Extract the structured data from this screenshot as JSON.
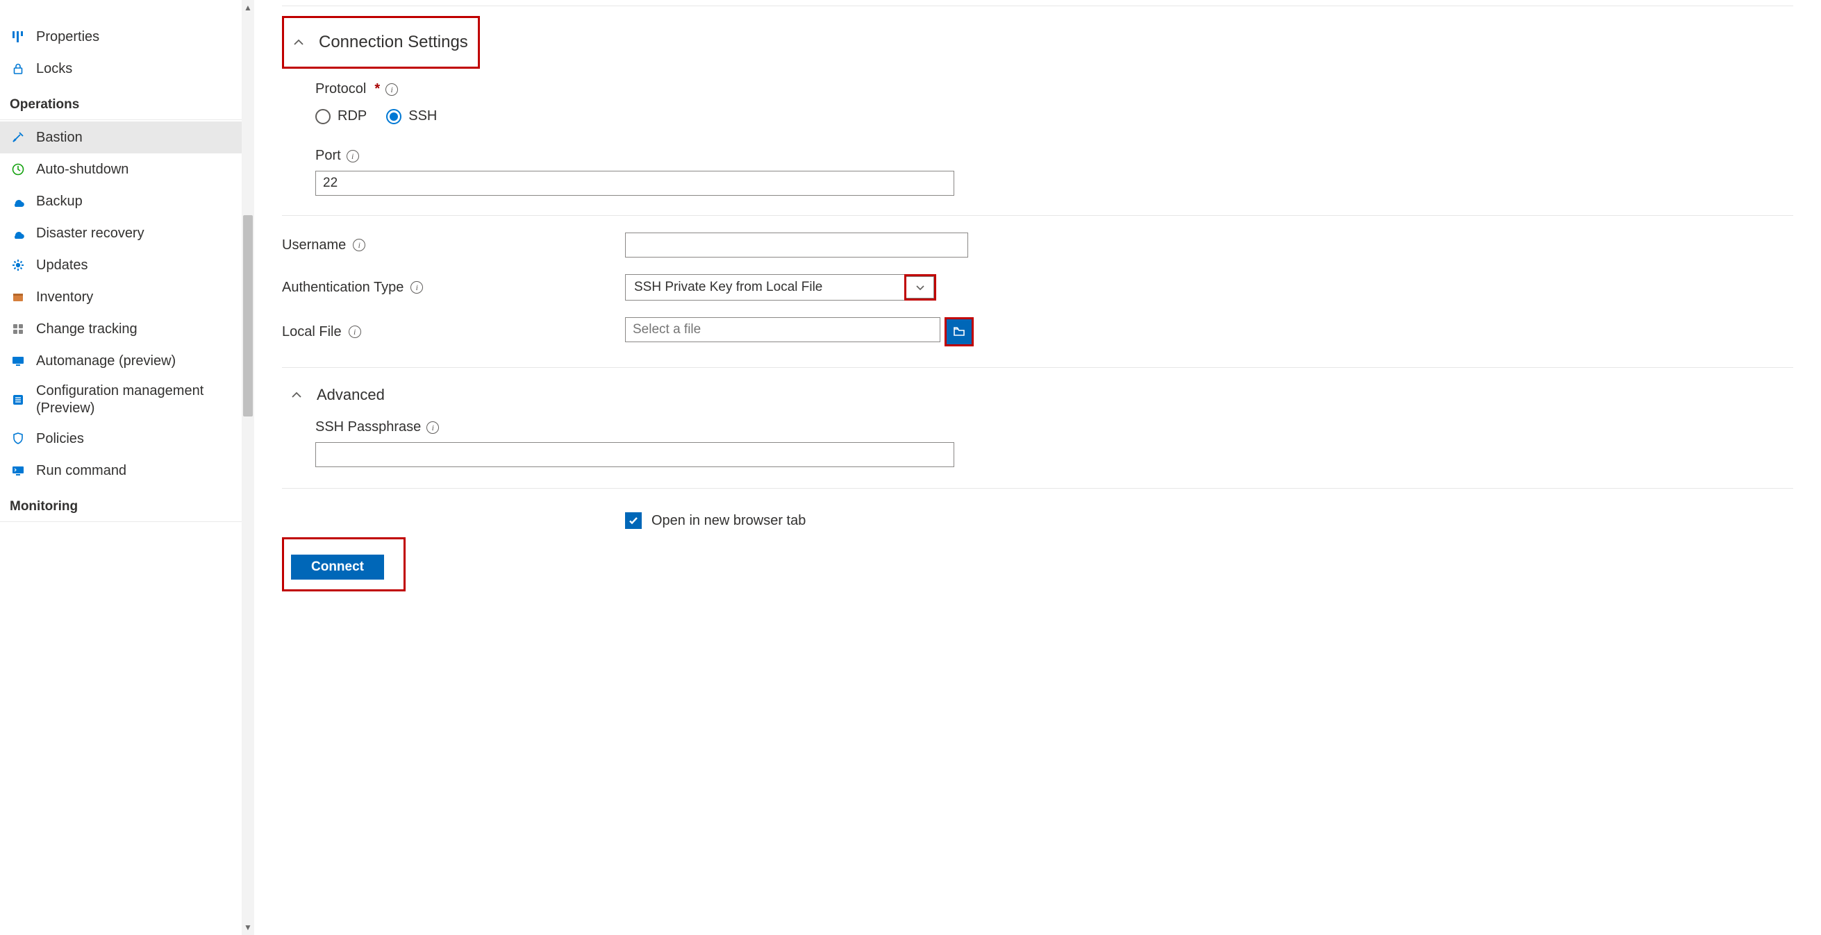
{
  "sidebar": {
    "items_top": [
      {
        "icon": "properties-icon",
        "label": "Properties"
      },
      {
        "icon": "lock-icon",
        "label": "Locks"
      }
    ],
    "heading_operations": "Operations",
    "items_ops": [
      {
        "icon": "bastion-icon",
        "label": "Bastion",
        "active": true
      },
      {
        "icon": "autoshutdown-icon",
        "label": "Auto-shutdown"
      },
      {
        "icon": "backup-icon",
        "label": "Backup"
      },
      {
        "icon": "disasterrecovery-icon",
        "label": "Disaster recovery"
      },
      {
        "icon": "updates-icon",
        "label": "Updates"
      },
      {
        "icon": "inventory-icon",
        "label": "Inventory"
      },
      {
        "icon": "changetracking-icon",
        "label": "Change tracking"
      },
      {
        "icon": "automanage-icon",
        "label": "Automanage (preview)"
      },
      {
        "icon": "configmgmt-icon",
        "label": "Configuration management (Preview)"
      },
      {
        "icon": "policies-icon",
        "label": "Policies"
      },
      {
        "icon": "runcommand-icon",
        "label": "Run command"
      }
    ],
    "heading_monitoring": "Monitoring"
  },
  "main": {
    "section_title": "Connection Settings",
    "protocol": {
      "label": "Protocol",
      "options": {
        "rdp": "RDP",
        "ssh": "SSH"
      },
      "selected": "ssh"
    },
    "port": {
      "label": "Port",
      "value": "22"
    },
    "username": {
      "label": "Username",
      "value": ""
    },
    "auth_type": {
      "label": "Authentication Type",
      "value": "SSH Private Key from Local File"
    },
    "local_file": {
      "label": "Local File",
      "placeholder": "Select a file"
    },
    "advanced": {
      "title": "Advanced",
      "ssh_passphrase_label": "SSH Passphrase",
      "ssh_passphrase_value": ""
    },
    "open_new_tab": {
      "label": "Open in new browser tab",
      "checked": true
    },
    "connect_label": "Connect"
  }
}
